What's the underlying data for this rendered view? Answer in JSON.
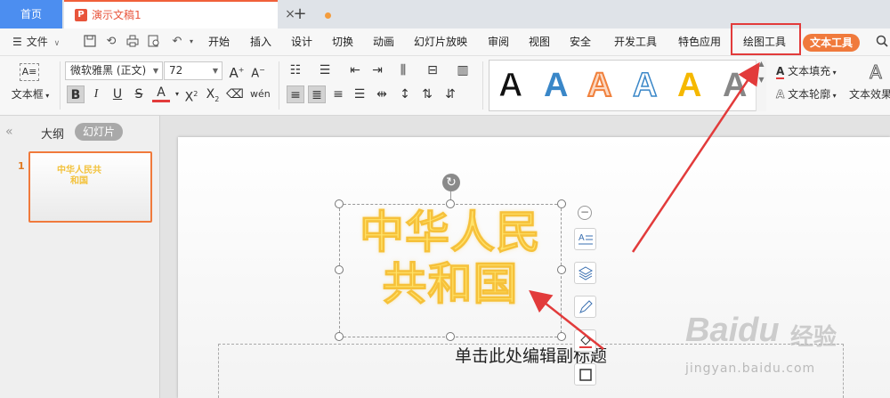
{
  "tabs": {
    "home": "首页",
    "document": "演示文稿1",
    "close": "×",
    "add": "+"
  },
  "menu": {
    "file": "文件",
    "items": [
      "开始",
      "插入",
      "设计",
      "切换",
      "动画",
      "幻灯片放映",
      "审阅",
      "视图",
      "安全",
      "开发工具",
      "特色应用",
      "绘图工具"
    ],
    "text_tool": "文本工具"
  },
  "ribbon": {
    "textbox_label": "文本框",
    "font_name": "微软雅黑 (正文)",
    "font_size": "72",
    "text_fill": "文本填充",
    "text_outline": "文本轮廓",
    "text_effect": "文本效果",
    "wordart_colors": [
      "#111111",
      "#3a87c8",
      "#f0803c",
      "#3a87c8",
      "#f5b800",
      "#666666"
    ]
  },
  "left_panel": {
    "outline_tab": "大纲",
    "slides_tab": "幻灯片",
    "slide_number": "1",
    "thumb_title": "中华人民共和国"
  },
  "slide": {
    "title_line1": "中华人民",
    "title_line2": "共和国",
    "subtitle_placeholder": "单击此处编辑副标题"
  },
  "watermark": {
    "logo": "Baidu",
    "cn": "经验",
    "url": "jingyan.baidu.com"
  },
  "colors": {
    "accent_orange": "#f07a3c",
    "annotation_red": "#e23b3b",
    "home_tab_blue": "#4c8ef0",
    "title_gold": "#f6c13a"
  }
}
